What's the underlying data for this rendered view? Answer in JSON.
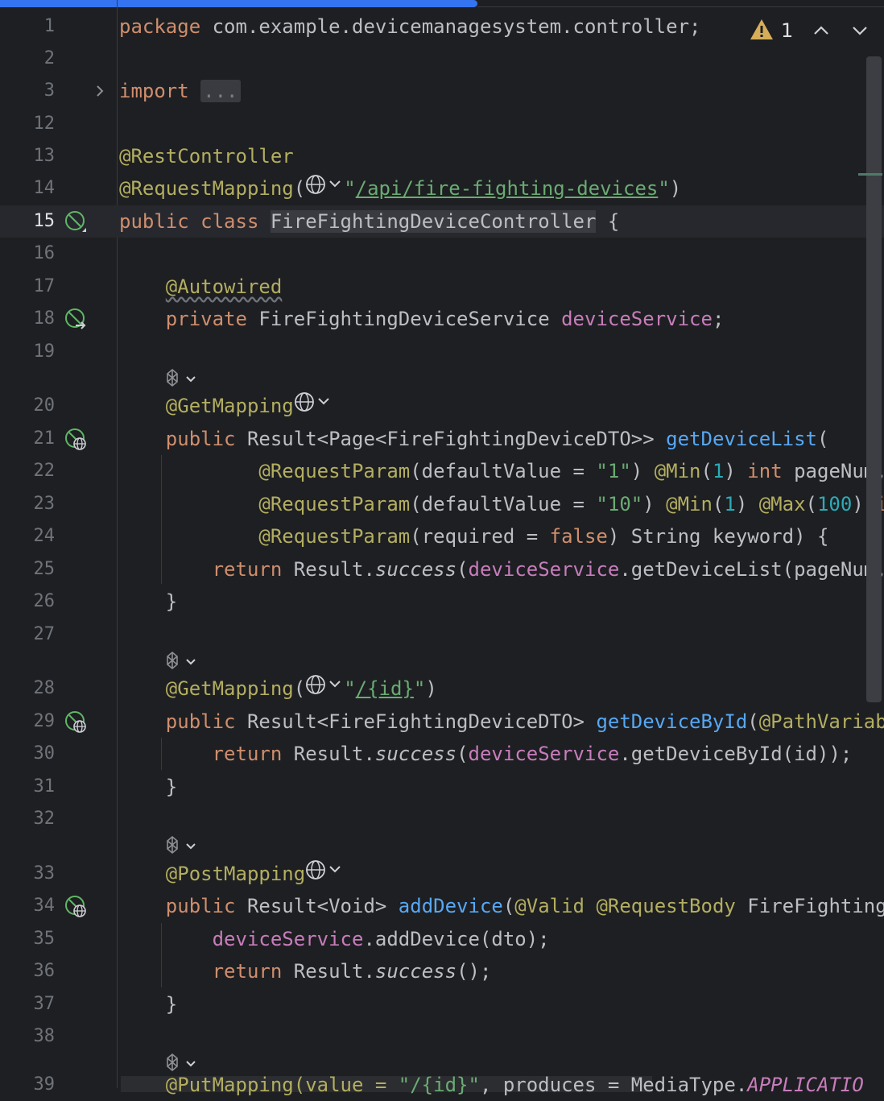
{
  "editor": {
    "accent_color": "#3574f0",
    "inspection": {
      "icon": "warning-icon",
      "count": "1"
    },
    "lines": [
      {
        "num": "1"
      },
      {
        "num": "2"
      },
      {
        "num": "3"
      },
      {
        "num": "12"
      },
      {
        "num": "13"
      },
      {
        "num": "14"
      },
      {
        "num": "15"
      },
      {
        "num": "16"
      },
      {
        "num": "17"
      },
      {
        "num": "18"
      },
      {
        "num": "19"
      },
      {
        "num": "20"
      },
      {
        "num": "21"
      },
      {
        "num": "22"
      },
      {
        "num": "23"
      },
      {
        "num": "24"
      },
      {
        "num": "25"
      },
      {
        "num": "26"
      },
      {
        "num": "27"
      },
      {
        "num": "28"
      },
      {
        "num": "29"
      },
      {
        "num": "30"
      },
      {
        "num": "31"
      },
      {
        "num": "32"
      },
      {
        "num": "33"
      },
      {
        "num": "34"
      },
      {
        "num": "35"
      },
      {
        "num": "36"
      },
      {
        "num": "37"
      },
      {
        "num": "38"
      },
      {
        "num": "39"
      }
    ],
    "tokens": {
      "package_kw": "package",
      "package_name": " com.example.devicemanagesystem.controller;",
      "import_kw": "import",
      "import_fold": "...",
      "rest_controller": "@RestController",
      "request_mapping": "@RequestMapping",
      "paren_open": "(",
      "paren_close": ")",
      "quote": "\"",
      "api_path": "/api/fire-fighting-devices",
      "public_kw": "public",
      "class_kw": "class",
      "class_name": "FireFightingDeviceController",
      "brace_open": "{",
      "brace_close": "}",
      "autowired": "@Autowired",
      "private_kw": "private",
      "service_type": "FireFightingDeviceService",
      "service_field": "deviceService",
      "semicolon": ";",
      "get_mapping": "@GetMapping",
      "list_return": "Result<Page<FireFightingDeviceDTO>>",
      "get_device_list": "getDeviceList",
      "request_param": "@RequestParam",
      "default_value": "(defaultValue = ",
      "str_1": "\"1\"",
      "str_10": "\"10\"",
      "min_ann": "@Min",
      "max_ann": "@Max",
      "num_1": "1",
      "num_100": "100",
      "int_kw": "int",
      "page_num": " pageNum,",
      "int_kw_cut": "int",
      "required_part": "(required = ",
      "false_kw": "false",
      "keyword_part": ") String keyword) {",
      "return_kw": "return",
      "result_dot": "Result.",
      "success": "success",
      "get_list_call": ".getDeviceList(pageNum, p",
      "id_path": "/{id}",
      "dto_return": "Result<FireFightingDeviceDTO>",
      "get_device_by_id": "getDeviceById",
      "path_variable": "@PathVariable",
      "get_by_id_call": ".getDeviceById(id));",
      "post_mapping": "@PostMapping",
      "void_return": "Result<Void>",
      "add_device": "addDevice",
      "valid_ann": "@Valid",
      "request_body": "@RequestBody",
      "dto_cut": "FireFightingDe",
      "add_device_call": ".addDevice(dto);",
      "success_call": "();",
      "put_mapping_cut": "@PutMapping(value = ",
      "produces_cut": ", produces = MediaType.",
      "app_json_cut": "APPLICATIO"
    }
  }
}
